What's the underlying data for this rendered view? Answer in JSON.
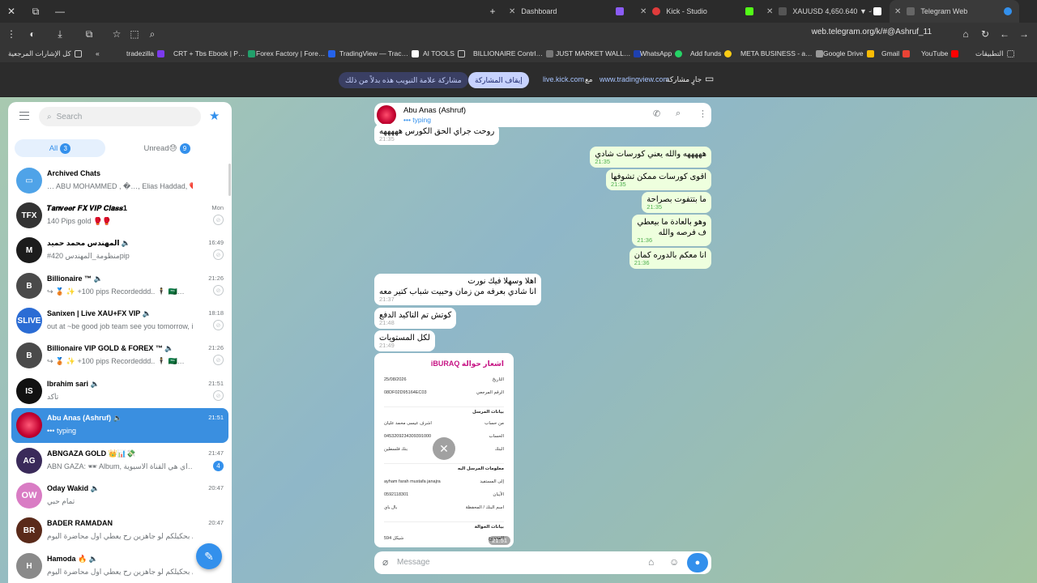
{
  "browser": {
    "tabs": [
      {
        "label": "Dashboard",
        "icon": "circle-icon"
      },
      {
        "label": "Kick - Studio",
        "icon": "kick-icon"
      },
      {
        "label": "XAUUSD 4,650.640 ▼ -0.0…",
        "icon": "tradingview-icon"
      },
      {
        "label": "Telegram Web",
        "icon": "telegram-icon"
      }
    ],
    "url": "web.telegram.org/k/#@Ashruf_11",
    "bookmarks": [
      "كل الإشارات المرجعية",
      "tradezilla",
      "CRT + Tbs Ebook | P…",
      "Forex Factory | Fore…",
      "TradingView — Trac…",
      "AI TOOLS",
      "BILLIONAIRE Contrl…",
      "JUST MARKET WALL…",
      "WhatsApp",
      "Add funds",
      "META BUSINESS - a…",
      "Google Drive",
      "Gmail",
      "YouTube",
      "التطبيقات"
    ],
    "sharing": {
      "hide_label": "مشاركة علامة التبويب هذه بدلاً من ذلك",
      "stop_label": "إيقاف المشاركة",
      "site1": "live.kick.com",
      "with": "مع",
      "site2": "www.tradingview.com",
      "status": "جارٍ مشاركة"
    }
  },
  "sidebar": {
    "search_placeholder": "Search",
    "filters": [
      {
        "label": "All",
        "count": "3"
      },
      {
        "label": "Unread😓",
        "count": "9"
      }
    ],
    "chats": [
      {
        "name": "Archived Chats",
        "preview": "… ABU MOHAMMED , �…, Elias Haddad, ❤️, AB…",
        "time": "",
        "avatar_color": "#4fa3e8",
        "avatar_text": "▭"
      },
      {
        "name": "𝑻𝒂𝒏𝒗𝒆𝒆𝒓 𝑭𝑿 𝑽𝑰𝑷 𝑪𝒍𝒂𝒔𝒔1",
        "preview": "140 Pips gold 🥊🥊",
        "time": "Mon",
        "avatar_color": "#333333",
        "avatar_text": "TFX"
      },
      {
        "name": "المهندس محمد حميد 🔈",
        "preview": "#منظومة_المهندس 420pip",
        "time": "16:49",
        "avatar_color": "#1c1c1c",
        "avatar_text": "M"
      },
      {
        "name": "Billionaire ™ 🔈",
        "preview": "↪ 🥉 ✨ +100 pips Recordeddd.. 🕴 🇸🇦…",
        "time": "21:26",
        "avatar_color": "#4a4a4a",
        "avatar_text": "B"
      },
      {
        "name": "Sanixen | Live XAU+FX VIP 🔈",
        "preview": "out at ~be good job team see you tomorrow, i…",
        "time": "18:18",
        "avatar_color": "#2b6cd4",
        "avatar_text": "SLIVE"
      },
      {
        "name": "Billionaire VIP GOLD & FOREX ™ 🔈",
        "preview": "↪ 🥉 ✨ +100 pips Recordeddd.. 🕴 🇸🇦…",
        "time": "21:26",
        "avatar_color": "#4a4a4a",
        "avatar_text": "B"
      },
      {
        "name": "Ibrahim sari 🔈",
        "preview": "تأكد",
        "time": "21:51",
        "avatar_color": "#111111",
        "avatar_text": "IS"
      },
      {
        "name": "Abu Anas (Ashruf) 🔈",
        "preview": "••• typing",
        "time": "21:51",
        "avatar_color": "#d4143a",
        "avatar_text": ""
      },
      {
        "name": "ABNGAZA GOLD 👑📊💸",
        "preview": "ABN GAZA: 🕶 Album, اي هي القناة الاسيوية…",
        "time": "21:47",
        "avatar_color": "#3a2a5a",
        "avatar_text": "AG",
        "badge": "4"
      },
      {
        "name": "Oday Wakid 🔈",
        "preview": "تمام حبي",
        "time": "20:47",
        "avatar_color": "#d97cc4",
        "avatar_text": "OW"
      },
      {
        "name": "BADER RAMADAN",
        "preview": "شادي بحكيلكم لو جاهزين رح يعطي اول محاضرة اليوم …",
        "time": "20:47",
        "avatar_color": "#5a2a1a",
        "avatar_text": "BR"
      },
      {
        "name": "Hamoda 🔥 🔈",
        "preview": "شادي بحكيلكم لو جاهزين رح يعطي اول محاضرة اليوم …",
        "time": "",
        "avatar_color": "#8a8a8a",
        "avatar_text": "H"
      }
    ]
  },
  "conversation": {
    "name": "Abu Anas (Ashruf)",
    "status": "••• typing",
    "messages": [
      {
        "dir": "in",
        "lines": [
          "روحت جراي الحق الكورس هههههه"
        ],
        "time": "21:35"
      },
      {
        "dir": "out",
        "lines": [
          "هههههه والله يعني كورسات شادي"
        ],
        "time": "21:35"
      },
      {
        "dir": "out",
        "lines": [
          "اقوى كورسات ممكن تشوفها"
        ],
        "time": "21:35"
      },
      {
        "dir": "out",
        "lines": [
          "ما بتتفوت بصراحة"
        ],
        "time": "21:35"
      },
      {
        "dir": "out",
        "lines": [
          "وهو بالعادة ما بيعطي",
          "ف فرصه والله"
        ],
        "time": "21:36"
      },
      {
        "dir": "out",
        "lines": [
          "انا معكم بالدوره كمان"
        ],
        "time": "21:36"
      },
      {
        "dir": "in",
        "lines": [
          "اهلا وسهلا فيك نورت",
          "انا شادي بعرفه من زمان وحبيت شباب كتير معه"
        ],
        "time": "21:37"
      },
      {
        "dir": "in",
        "lines": [
          "كوتش تم التاكيد الدفع"
        ],
        "time": "21:48"
      },
      {
        "dir": "in",
        "lines": [
          "لكل المستويات"
        ],
        "time": "21:49"
      }
    ],
    "receipt": {
      "title": "اشعار حوالة iBURAQ",
      "rows": [
        {
          "label": "التاريخ",
          "value": "25/08/2026"
        },
        {
          "label": "الرقم المرجعي",
          "value": "08DF02D95164EC03"
        },
        {
          "label": "من حساب",
          "value": "اشرف عيسى محمد عليان"
        },
        {
          "label": "الحساب",
          "value": "0453209234309391000"
        },
        {
          "label": "البنك",
          "value": "بنك فلسطين"
        },
        {
          "label": "إلى المستفيد",
          "value": "ayham farah mustafa janajra"
        },
        {
          "label": "الآيبان",
          "value": "0592118301"
        },
        {
          "label": "اسم البنك / المحفظة",
          "value": "بال باي"
        },
        {
          "label": "المجموع",
          "value": "594 شيكل"
        }
      ],
      "sections": [
        "بيانات المرسل",
        "معلومات المرسل اليه",
        "بيانات الحوالة"
      ],
      "time": "21:51"
    },
    "composer_placeholder": "Message"
  },
  "colors": {
    "accent": "#3390ec",
    "outgoing": "#eeffde",
    "selected": "#3a8fe0"
  }
}
